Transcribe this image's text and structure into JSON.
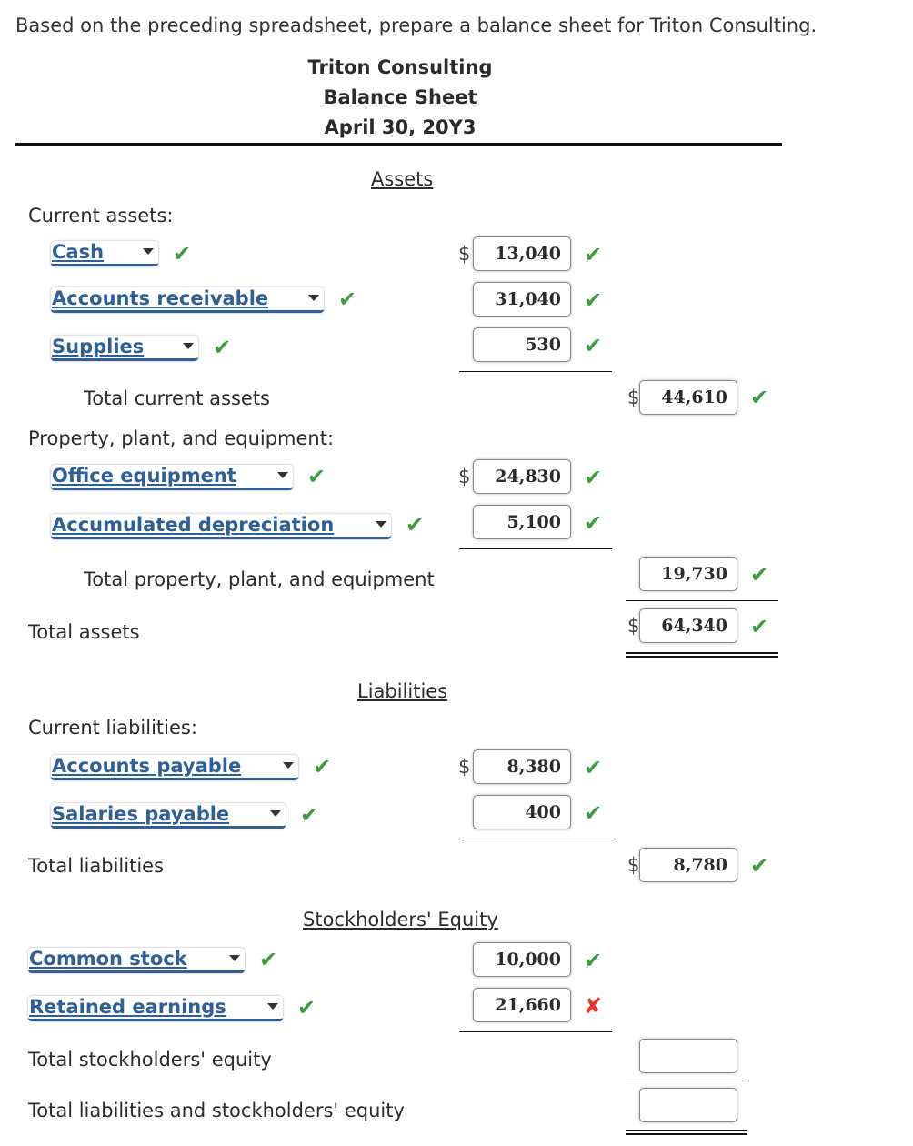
{
  "prompt": "Based on the preceding spreadsheet, prepare a balance sheet for Triton Consulting.",
  "header": {
    "company": "Triton Consulting",
    "statement": "Balance Sheet",
    "date": "April 30, 20Y3"
  },
  "assets": {
    "section_title": "Assets",
    "current_label": "Current assets:",
    "current_items": [
      {
        "account": "Cash",
        "amount": "13,040",
        "status": "correct",
        "dollar": "$"
      },
      {
        "account": "Accounts receivable",
        "amount": "31,040",
        "status": "correct"
      },
      {
        "account": "Supplies",
        "amount": "530",
        "status": "correct"
      }
    ],
    "total_current_label": "Total current assets",
    "total_current": {
      "amount": "44,610",
      "status": "correct",
      "dollar": "$"
    },
    "ppe_label": "Property, plant, and equipment:",
    "ppe_items": [
      {
        "account": "Office equipment",
        "amount": "24,830",
        "status": "correct",
        "dollar": "$"
      },
      {
        "account": "Accumulated depreciation",
        "amount": "5,100",
        "status": "correct"
      }
    ],
    "total_ppe_label": "Total property, plant, and equipment",
    "total_ppe": {
      "amount": "19,730",
      "status": "correct"
    },
    "total_assets_label": "Total assets",
    "total_assets": {
      "amount": "64,340",
      "status": "correct",
      "dollar": "$"
    }
  },
  "liabilities": {
    "section_title": "Liabilities",
    "current_label": "Current liabilities:",
    "items": [
      {
        "account": "Accounts payable",
        "amount": "8,380",
        "status": "correct",
        "dollar": "$"
      },
      {
        "account": "Salaries payable",
        "amount": "400",
        "status": "correct"
      }
    ],
    "total_label": "Total liabilities",
    "total": {
      "amount": "8,780",
      "status": "correct",
      "dollar": "$"
    }
  },
  "equity": {
    "section_title": "Stockholders' Equity",
    "items": [
      {
        "account": "Common stock",
        "amount": "10,000",
        "status": "correct"
      },
      {
        "account": "Retained earnings",
        "amount": "21,660",
        "status": "incorrect"
      }
    ],
    "total_label": "Total stockholders' equity",
    "total": {
      "amount": ""
    },
    "total_le_label": "Total liabilities and stockholders' equity",
    "total_le": {
      "amount": ""
    }
  },
  "marks": {
    "correct": "✔",
    "incorrect": "✘"
  }
}
